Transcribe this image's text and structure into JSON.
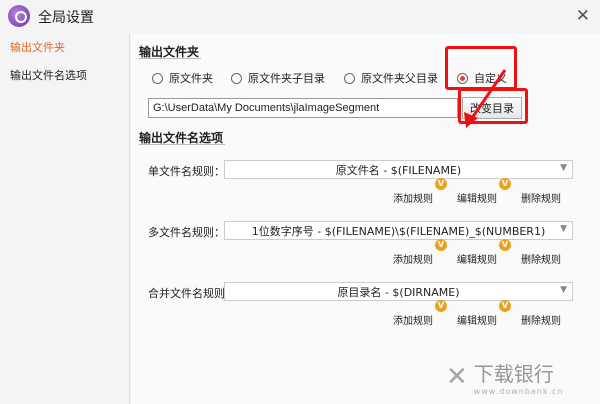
{
  "window": {
    "title": "全局设置",
    "close_glyph": "✕"
  },
  "sidebar": {
    "items": [
      {
        "label": "输出文件夹"
      },
      {
        "label": "输出文件名选项"
      }
    ]
  },
  "output_folder": {
    "title": "输出文件夹",
    "options": [
      {
        "label": "原文件夹",
        "checked": false
      },
      {
        "label": "原文件夹子目录",
        "checked": false
      },
      {
        "label": "原文件夹父目录",
        "checked": false
      },
      {
        "label": "自定义",
        "checked": true
      }
    ],
    "path_value": "G:\\UserData\\My Documents\\jlaImageSegment",
    "browse_label": "改变目录"
  },
  "filename_options": {
    "title": "输出文件名选项",
    "rules": [
      {
        "label": "单文件名规则：",
        "value": "原文件名 - $(FILENAME)"
      },
      {
        "label": "多文件名规则：",
        "value": "1位数字序号 - $(FILENAME)\\$(FILENAME)_$(NUMBER1)"
      },
      {
        "label": "合并文件名规则：",
        "value": "原目录名 - $(DIRNAME)"
      }
    ],
    "actions": {
      "add": "添加规则",
      "edit": "编辑规则",
      "delete": "删除规则"
    },
    "vip_badge": "V"
  },
  "watermark": {
    "title": "下载银行",
    "subtitle": "www.downbank.cn"
  },
  "colors": {
    "accent": "#e06a2a",
    "annotation": "#e11111",
    "vip": "#f0a020"
  }
}
